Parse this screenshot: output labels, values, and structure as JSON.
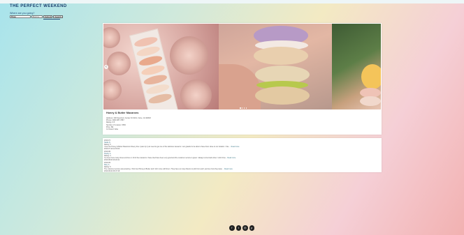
{
  "header": {
    "title": "THE PERFECT WEEKEND",
    "search_label": "Where are you going?",
    "search_value": "Braw",
    "location_placeholder": "Burma",
    "button_one": "Submit",
    "button_two": "Search"
  },
  "business": {
    "name": "Honey & Butter Macarons",
    "address": "Address: 400 Spectrum Center Dr #101, Irvine, CA 92618",
    "phone": "Phone: (949) 387-7887",
    "rating": "Rating: 4.5",
    "reviews": "Number of reviews: 1584",
    "price": "Price: $$",
    "hours": "Is Closed: false"
  },
  "carousel": {
    "prev_glyph": "‹",
    "dot_count": 4,
    "active_dot": 0
  },
  "reviews": [
    {
      "date": "2019-07-",
      "user": "Nadia N.",
      "rating": "Rating: 5",
      "text": "I love the Honey & Butter Macarons! Every time I pass by I just need to get one of the delicious desserts. I am grateful to be able to have them close to our location. I like ...",
      "more": "Read more",
      "time": "2019-07-19 12:15:00"
    },
    {
      "date": "2019-08-",
      "user": "Shelby A.",
      "rating": "Rating: 4",
      "text": "I've been here many times and love it. All of the macarons I have tried have been very good and the customer service is great. I always come back when I visit Irvine...",
      "more": "Read more",
      "time": "2019-08-03 20:22:41"
    },
    {
      "date": "2019-06-",
      "user": "Mary A.",
      "rating": "Rating: 5",
      "text": "The customer service was amazing. I first tried Honey & Butter and I fell in love with them. They have so many flavors to pick from and I just love how they taste ...",
      "more": "Read more",
      "time": "2019-06-02 09:47:18"
    }
  ],
  "footer": {
    "facebook_glyph": "f",
    "twitter_glyph": "t",
    "instagram_glyph": "◎",
    "pinterest_glyph": "p"
  },
  "colors": {
    "title": "#1b3f6e",
    "accent": "#3f7a8a"
  }
}
